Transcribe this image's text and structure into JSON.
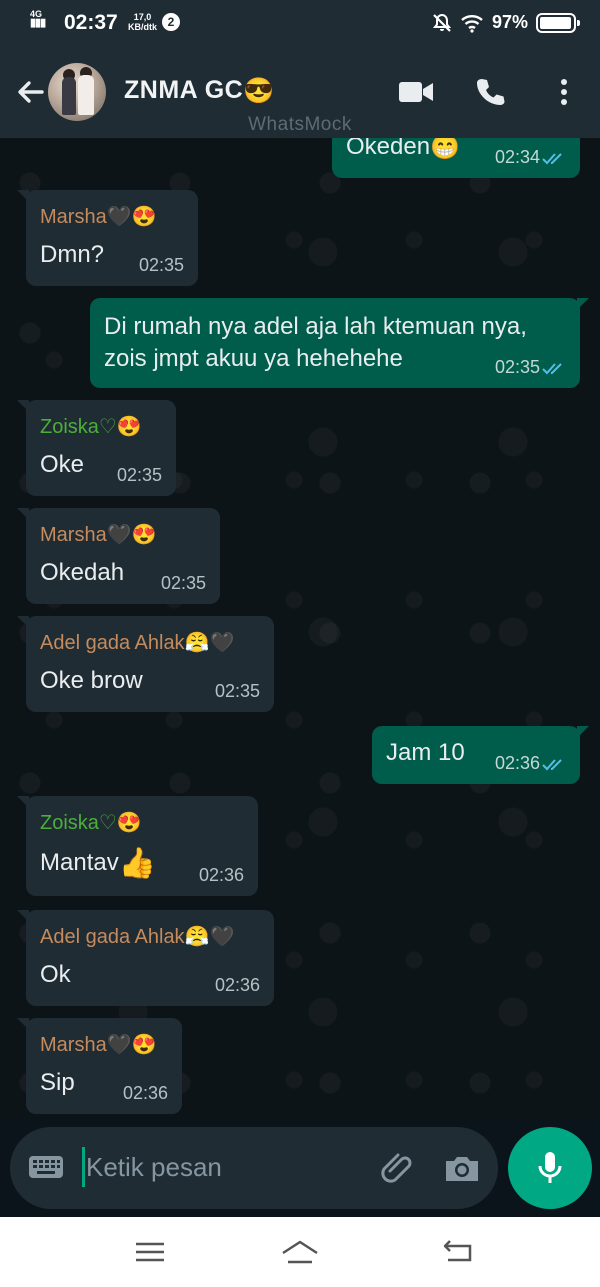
{
  "status_bar": {
    "network": "4G",
    "time": "02:37",
    "speed_value": "17,0",
    "speed_unit": "KB/dtk",
    "notification_count": "2",
    "battery_text": "97%",
    "battery_level": 0.97
  },
  "header": {
    "title": "ZNMA GC",
    "title_emoji": "😎",
    "watermark": "WhatsMock",
    "icons": [
      "back-arrow-icon",
      "video-call-icon",
      "phone-icon",
      "more-options-icon"
    ]
  },
  "messages": [
    {
      "direction": "out",
      "text": "Okeden",
      "emoji": "😁",
      "time": "02:34",
      "read": true
    },
    {
      "direction": "in",
      "sender": "Marsha🖤😍",
      "sender_color": "#c68b5d",
      "text": "Dmn?",
      "time": "02:35"
    },
    {
      "direction": "out",
      "text": "Di rumah nya adel aja lah ktemuan nya,",
      "text2": "zois jmpt akuu ya hehehehe",
      "time": "02:35",
      "read": true
    },
    {
      "direction": "in",
      "sender": "Zoiska♡😍",
      "sender_color": "#4caf3a",
      "text": "Oke",
      "time": "02:35"
    },
    {
      "direction": "in",
      "sender": "Marsha🖤😍",
      "sender_color": "#c68b5d",
      "text": "Okedah",
      "time": "02:35"
    },
    {
      "direction": "in",
      "sender": "Adel gada Ahlak😤🖤",
      "sender_color": "#c68b5d",
      "text": "Oke brow",
      "time": "02:35"
    },
    {
      "direction": "out",
      "text": "Jam 10",
      "time": "02:36",
      "read": true
    },
    {
      "direction": "in",
      "sender": "Zoiska♡😍",
      "sender_color": "#4caf3a",
      "text": "Mantav",
      "emoji": "👍",
      "time": "02:36"
    },
    {
      "direction": "in",
      "sender": "Adel gada Ahlak😤🖤",
      "sender_color": "#c68b5d",
      "text": "Ok",
      "time": "02:36"
    },
    {
      "direction": "in",
      "sender": "Marsha🖤😍",
      "sender_color": "#c68b5d",
      "text": "Sip",
      "time": "02:36"
    }
  ],
  "input": {
    "placeholder": "Ketik pesan",
    "value": ""
  },
  "colors": {
    "bar_bg": "#1f2c34",
    "chat_bg": "#0b141a",
    "out_bubble": "#005c4b",
    "in_bubble": "#1f2c34",
    "accent": "#00a884",
    "read_tick": "#53bdeb"
  }
}
